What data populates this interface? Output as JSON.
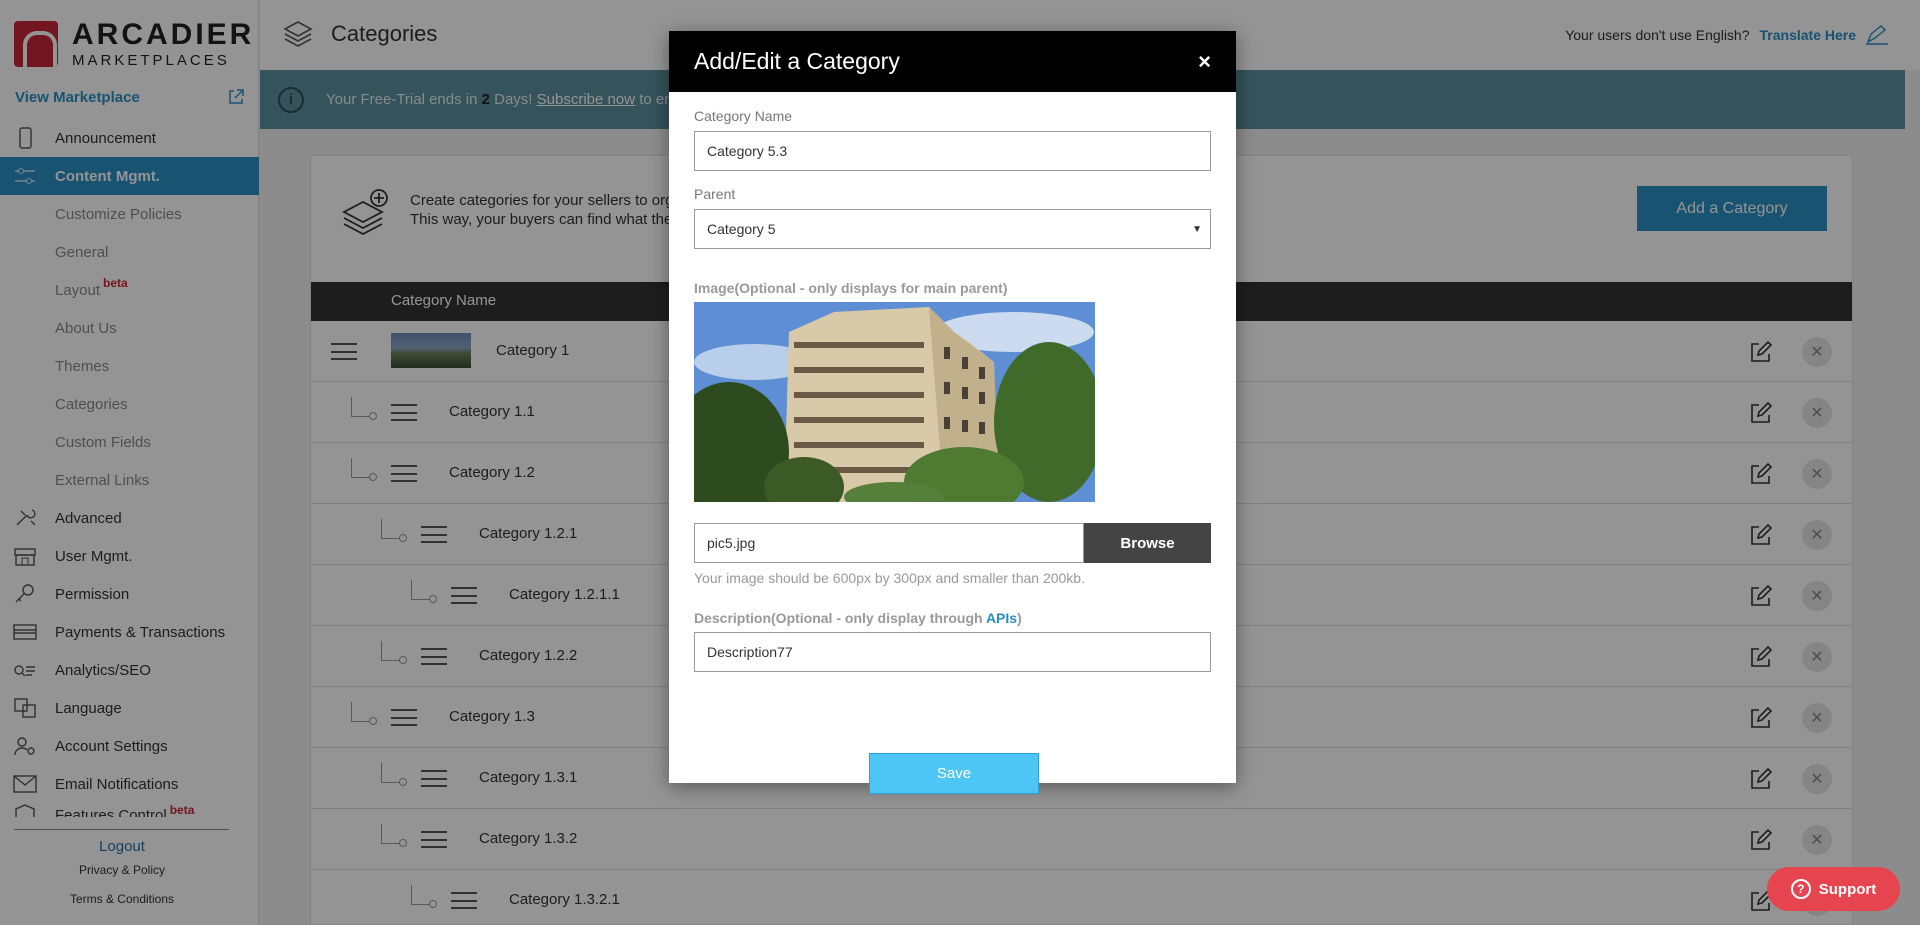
{
  "sidebar": {
    "logo_line1": "ARCADIER",
    "logo_line2": "MARKETPLACES",
    "view_marketplace": "View Marketplace",
    "items": [
      {
        "label": "Announcement",
        "icon": "phone-icon"
      },
      {
        "label": "Content Mgmt.",
        "icon": "sliders-icon",
        "active": true
      },
      {
        "label": "Customize Policies",
        "sub": true
      },
      {
        "label": "General",
        "sub": true
      },
      {
        "label": "Layout",
        "sub": true,
        "badge": "beta"
      },
      {
        "label": "About Us",
        "sub": true
      },
      {
        "label": "Themes",
        "sub": true
      },
      {
        "label": "Categories",
        "sub": true
      },
      {
        "label": "Custom Fields",
        "sub": true
      },
      {
        "label": "External Links",
        "sub": true
      },
      {
        "label": "Advanced",
        "icon": "tools-icon"
      },
      {
        "label": "User Mgmt.",
        "icon": "store-icon"
      },
      {
        "label": "Permission",
        "icon": "key-icon"
      },
      {
        "label": "Payments & Transactions",
        "icon": "card-icon"
      },
      {
        "label": "Analytics/SEO",
        "icon": "analytics-icon"
      },
      {
        "label": "Language",
        "icon": "language-icon"
      },
      {
        "label": "Account Settings",
        "icon": "user-gear-icon"
      },
      {
        "label": "Email Notifications",
        "icon": "envelope-icon"
      },
      {
        "label": "Features Control",
        "icon": "features-icon",
        "badge": "beta"
      }
    ],
    "logout": "Logout",
    "privacy": "Privacy & Policy",
    "terms": "Terms & Conditions"
  },
  "header": {
    "title": "Categories",
    "translate_prompt": "Your users don't use English?",
    "translate_link": "Translate Here"
  },
  "trial_banner": {
    "prefix": "Your Free-Trial ends in ",
    "days": "2",
    "days_suffix": " Days! ",
    "link": "Subscribe now",
    "suffix": " to enj"
  },
  "panel": {
    "desc_line1": "Create categories for your sellers to org",
    "desc_line2": "This way, your buyers can find what the",
    "add_button": "Add a Category",
    "column_header": "Category Name",
    "rows": [
      {
        "name": "Category 1",
        "level": 0,
        "thumb": true
      },
      {
        "name": "Category 1.1",
        "level": 1
      },
      {
        "name": "Category 1.2",
        "level": 1
      },
      {
        "name": "Category 1.2.1",
        "level": 2
      },
      {
        "name": "Category 1.2.1.1",
        "level": 3
      },
      {
        "name": "Category 1.2.2",
        "level": 2
      },
      {
        "name": "Category 1.3",
        "level": 1
      },
      {
        "name": "Category 1.3.1",
        "level": 2
      },
      {
        "name": "Category 1.3.2",
        "level": 2
      },
      {
        "name": "Category 1.3.2.1",
        "level": 3
      }
    ]
  },
  "modal": {
    "title": "Add/Edit a Category",
    "close": "×",
    "name_label": "Category Name",
    "name_value": "Category 5.3",
    "parent_label": "Parent",
    "parent_value": "Category 5",
    "image_label": "Image(Optional - only displays for main parent)",
    "file_name": "pic5.jpg",
    "browse": "Browse",
    "image_hint": "Your image should be 600px by 300px and smaller than 200kb.",
    "desc_label_prefix": "Description(Optional - only display through ",
    "desc_label_link": "APIs",
    "desc_label_suffix": ")",
    "desc_value": "Description77",
    "save": "Save"
  },
  "support": {
    "label": "Support"
  },
  "colors": {
    "accent": "#2a8fc3",
    "brand_red": "#c8263a",
    "banner": "#5a8f9c",
    "save_button": "#4dc5f5",
    "support": "#e6444f"
  }
}
